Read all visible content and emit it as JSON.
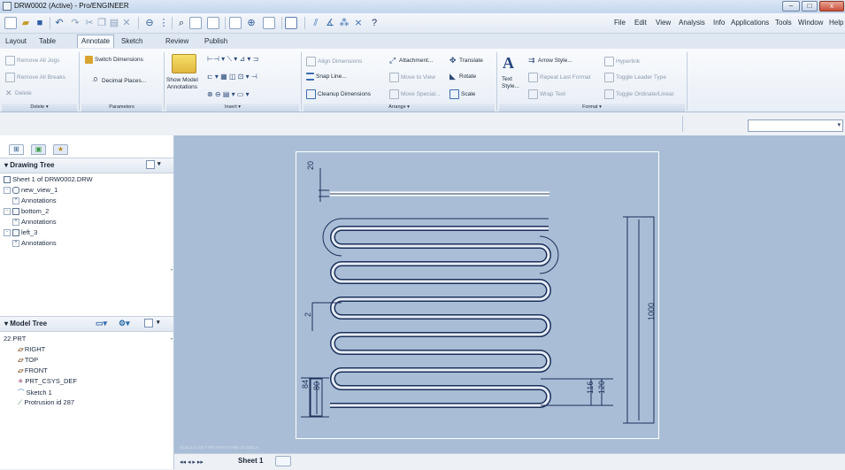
{
  "window": {
    "title": "DRW0002 (Active) - Pro/ENGINEER",
    "controls": [
      "–",
      "□",
      "x"
    ]
  },
  "menubar": {
    "items": [
      "File",
      "Edit",
      "View",
      "Analysis",
      "Info",
      "Applications",
      "Tools",
      "Window",
      "Help"
    ]
  },
  "ribbon_tabs": {
    "items": [
      "Layout",
      "Table",
      "Annotate",
      "Sketch",
      "Review",
      "Publish"
    ],
    "active": "Annotate"
  },
  "ribbon": {
    "delete_group": {
      "remove_all_jogs": "Remove All Jogs",
      "remove_all_breaks": "Remove All Breaks",
      "delete": "Delete",
      "footer": "Delete"
    },
    "parameters_group": {
      "switch_dimensions": "Switch Dimensions",
      "decimal_places": "Decimal Places...",
      "footer": "Parameters"
    },
    "insert_group": {
      "show_model_annotations_1": "Show Model",
      "show_model_annotations_2": "Annotations",
      "footer": "Insert"
    },
    "arrange_group": {
      "align_dimensions": "Align Dimensions",
      "snap_line": "Snap Line...",
      "cleanup_dimensions": "Cleanup Dimensions",
      "attachment": "Attachment...",
      "move_to_view": "Move to View",
      "move_special": "Move Special...",
      "translate": "Translate",
      "rotate": "Rotate",
      "scale": "Scale",
      "footer": "Arrange"
    },
    "format_group": {
      "text_style_1": "Text",
      "text_style_2": "Style...",
      "arrow_style": "Arrow Style...",
      "repeat_last_format": "Repeat Last Format",
      "wrap_text": "Wrap Text",
      "hyperlink": "Hyperlink",
      "toggle_leader_type": "Toggle Leader Type",
      "toggle_ordinate_linear": "Toggle Ordinate/Linear",
      "footer": "Format"
    }
  },
  "drawing_tree": {
    "title": "Drawing Tree",
    "items": [
      {
        "label": "Sheet 1 of DRW0002.DRW",
        "level": 0
      },
      {
        "label": "new_view_1",
        "level": 1
      },
      {
        "label": "Annotations",
        "level": 2
      },
      {
        "label": "bottom_2",
        "level": 1
      },
      {
        "label": "Annotations",
        "level": 2
      },
      {
        "label": "left_3",
        "level": 1
      },
      {
        "label": "Annotations",
        "level": 2
      }
    ]
  },
  "model_tree": {
    "title": "Model Tree",
    "items": [
      {
        "label": "22.PRT",
        "level": 0
      },
      {
        "label": "RIGHT",
        "level": 1
      },
      {
        "label": "TOP",
        "level": 1
      },
      {
        "label": "FRONT",
        "level": 1
      },
      {
        "label": "PRT_CSYS_DEF",
        "level": 1
      },
      {
        "label": "Sketch 1",
        "level": 1
      },
      {
        "label": "Protrusion id 287",
        "level": 1
      }
    ]
  },
  "drawing": {
    "dims": {
      "top_20": "20",
      "left_2": "2",
      "left_84": "84",
      "left_80": "80",
      "right_116": "116",
      "right_120": "120",
      "vertical_1000": "1000"
    },
    "scale_text": "SCALE 0.100   TYPE PART   NAME 22   SIZE A"
  },
  "bottom": {
    "nav": "◂◂  ◂  ▸  ▸▸",
    "sheet_tab": "Sheet 1"
  },
  "colors": {
    "canvas": "#a9bed6",
    "sheet_line": "#ffffff",
    "geometry": "#1c2f5a"
  }
}
